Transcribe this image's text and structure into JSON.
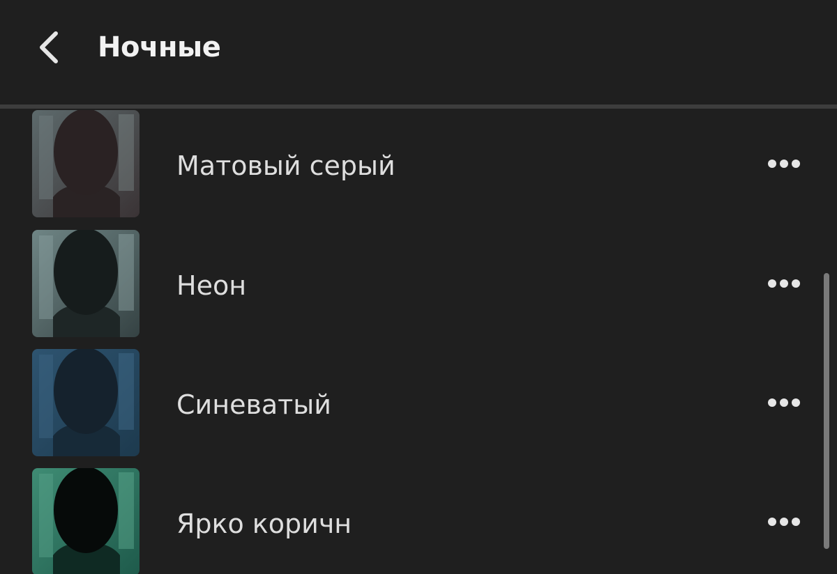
{
  "header": {
    "title": "Ночные",
    "back_icon": "chevron-left-icon"
  },
  "presets": [
    {
      "label": "Матовый серый",
      "thumb_tint": "#3a3335",
      "more_icon": "more-horizontal-icon"
    },
    {
      "label": "Неон",
      "thumb_tint": "#354243",
      "more_icon": "more-horizontal-icon"
    },
    {
      "label": "Синеватый",
      "thumb_tint": "#1d3a4e",
      "more_icon": "more-horizontal-icon"
    },
    {
      "label": "Ярко коричн",
      "thumb_tint": "#1e5a4b",
      "more_icon": "more-horizontal-icon"
    }
  ],
  "colors": {
    "background": "#1f1f1f",
    "divider": "#3d3d3d",
    "text": "#dedede"
  }
}
